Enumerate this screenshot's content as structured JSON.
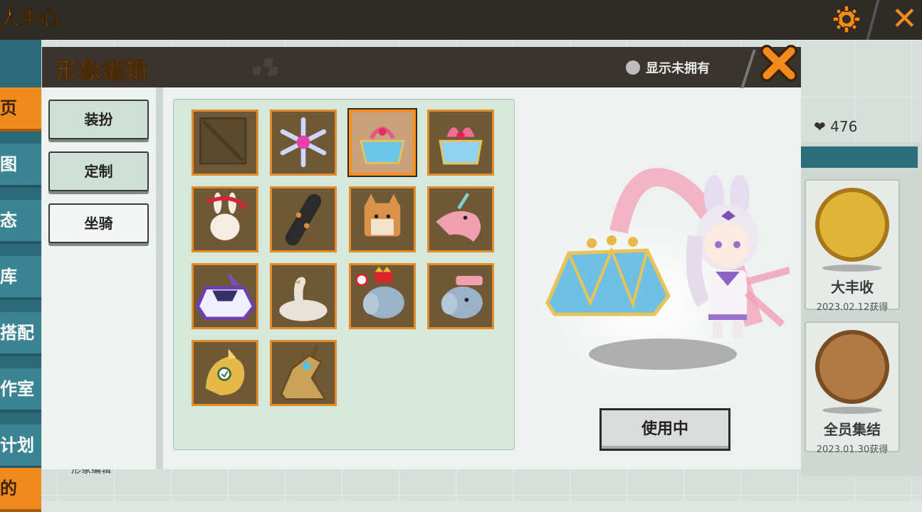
{
  "background": {
    "header_title": "人中心",
    "settings_icon": "gear-icon",
    "close_icon": "close-icon",
    "nav_items": [
      {
        "label": "页",
        "selected": true
      },
      {
        "label": "图",
        "selected": false
      },
      {
        "label": "态",
        "selected": false
      },
      {
        "label": "库",
        "selected": false
      },
      {
        "label": "搭配",
        "selected": false
      },
      {
        "label": "作室",
        "selected": false
      },
      {
        "label": "计划",
        "selected": false
      },
      {
        "label": "的",
        "selected": true
      }
    ],
    "likes_icon": "hearts-icon",
    "likes_count": "476",
    "badges": [
      {
        "name": "大丰收",
        "date": "2023.02.12获得",
        "icon": "harvest-medal-icon"
      },
      {
        "name": "全员集结",
        "date": "2023.01.30获得",
        "icon": "cow-medal-icon"
      }
    ],
    "bottom_label": "形象编辑"
  },
  "modal": {
    "title": "形象编辑",
    "show_unowned_label": "显示未拥有",
    "show_unowned_checked": false,
    "close_icon": "close-x-icon",
    "tabs": [
      {
        "label": "装扮"
      },
      {
        "label": "定制"
      },
      {
        "label": "坐骑"
      }
    ],
    "selected_tab": "坐骑",
    "items": [
      {
        "icon": "empty-slot-icon",
        "selected": false
      },
      {
        "icon": "snowflake-icon",
        "selected": false
      },
      {
        "icon": "crystal-gift-box-icon",
        "selected": true
      },
      {
        "icon": "ribbon-gift-box-icon",
        "selected": false
      },
      {
        "icon": "bunny-lantern-icon",
        "selected": false
      },
      {
        "icon": "skateboard-icon",
        "selected": false
      },
      {
        "icon": "shiba-dog-icon",
        "selected": false
      },
      {
        "icon": "pink-unicorn-fish-icon",
        "selected": false
      },
      {
        "icon": "purple-race-car-icon",
        "selected": false
      },
      {
        "icon": "swan-float-icon",
        "selected": false
      },
      {
        "icon": "circus-elephant-crown-icon",
        "selected": false
      },
      {
        "icon": "elephant-pink-hat-icon",
        "selected": false
      },
      {
        "icon": "golden-bird-icon",
        "selected": false
      },
      {
        "icon": "mecha-horse-icon",
        "selected": false
      }
    ],
    "preview_icon": "avatar-on-crystal-box-icon",
    "use_button_label": "使用中",
    "colors": {
      "accent": "#f28a1c",
      "header": "#3a342f",
      "grid_bg": "#d6e8dc",
      "item_bg": "#6e5836"
    }
  }
}
